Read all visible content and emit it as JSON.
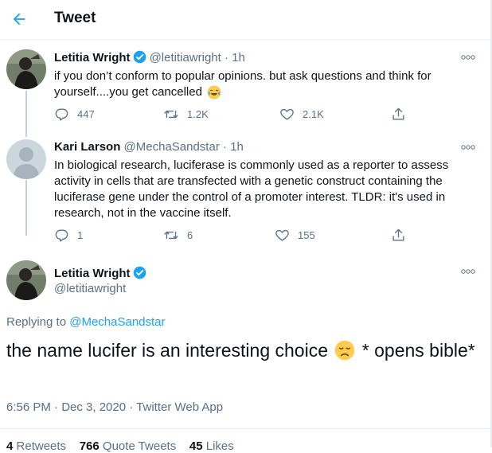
{
  "header": {
    "title": "Tweet",
    "back_icon": "arrow-left-icon"
  },
  "colors": {
    "accent": "#1da1f2",
    "muted": "#5b7083",
    "verified": "#1da1f2",
    "border": "#e6ecf0"
  },
  "thread": [
    {
      "name": "Letitia Wright",
      "verified": true,
      "handle": "@letitiawright",
      "time": "· 1h",
      "text": "if you don’t conform to popular opinions. but ask questions and think for yourself....you get cancelled",
      "text_emoji": "face-with-tears-of-joy-emoji",
      "replies": "447",
      "retweets": "1.2K",
      "likes": "2.1K"
    },
    {
      "name": "Kari Larson",
      "verified": false,
      "handle": "@MechaSandstar",
      "time": "· 1h",
      "text": "In biological research, luciferase is commonly used as a reporter to assess activity in cells that are transfected with a genetic construct containing the luciferase gene under the control of a promoter interest.  TLDR: it's used in research, not in the vaccine itself.",
      "replies": "1",
      "retweets": "6",
      "likes": "155"
    }
  ],
  "main": {
    "name": "Letitia Wright",
    "verified": true,
    "handle": "@letitiawright",
    "replying_prefix": "Replying to",
    "replying_to": "@MechaSandstar",
    "text_before": "the name lucifer is an interesting choice",
    "text_emoji": "disappointed-face-emoji",
    "text_after": "* opens bible*",
    "timestamp": "6:56 PM · Dec 3, 2020",
    "dot": " · ",
    "source": "Twitter Web App",
    "retweets_count": "4",
    "retweets_label": "Retweets",
    "quotes_count": "766",
    "quotes_label": "Quote Tweets",
    "likes_count": "45",
    "likes_label": "Likes"
  }
}
